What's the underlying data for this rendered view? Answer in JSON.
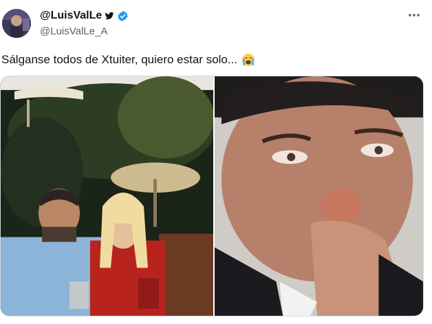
{
  "tweet": {
    "display_name": "@LuisValLe",
    "handle": "@LuisValLe_A",
    "text": "Sálganse todos de Xtuiter, quiero estar solo...",
    "emoji": "loudly-crying-face"
  },
  "icons": {
    "bird": "bird-icon",
    "verified": "verified-badge-icon",
    "more": "more-options-icon"
  },
  "colors": {
    "verified": "#1d9bf0",
    "handle": "#536471",
    "text": "#0f1419",
    "border": "#cfd9de"
  },
  "media": {
    "count": 2
  }
}
